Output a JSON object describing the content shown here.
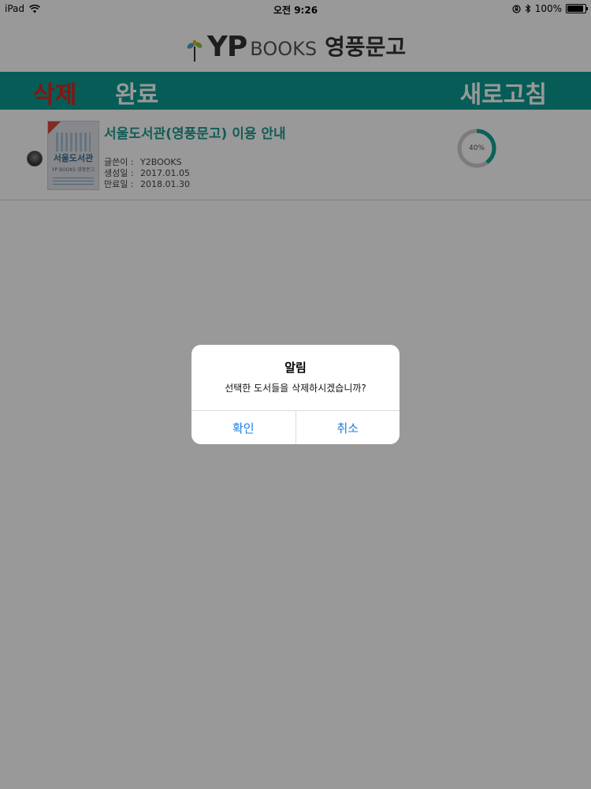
{
  "status_bar": {
    "device": "iPad",
    "time": "오전 9:26",
    "battery": "100%",
    "battery_level": 1.0
  },
  "header": {
    "logo_yp": "YP",
    "logo_books": "BOOKS",
    "logo_korean": "영풍문고"
  },
  "toolbar": {
    "delete_label": "삭제",
    "done_label": "완료",
    "refresh_label": "새로고침"
  },
  "books": [
    {
      "title": "서울도서관(영풍문고) 이용 안내",
      "cover_title": "서울도서관",
      "cover_brand": "YP BOOKS 영풍문고",
      "meta": [
        {
          "label": "글쓴이 :",
          "value": "Y2BOOKS"
        },
        {
          "label": "생성일 :",
          "value": "2017.01.05"
        },
        {
          "label": "만료일 :",
          "value": "2018.01.30"
        }
      ],
      "progress_label": "40%",
      "progress_value": 0.4
    }
  ],
  "alert": {
    "title": "알림",
    "message": "선택한 도서들을 삭제하시겠습니까?",
    "confirm_label": "확인",
    "cancel_label": "취소"
  },
  "colors": {
    "toolbar_bg": "#0a9b91",
    "delete_red": "#e0231c",
    "title_teal": "#1f9a8f",
    "alert_button": "#1b7fe0"
  }
}
